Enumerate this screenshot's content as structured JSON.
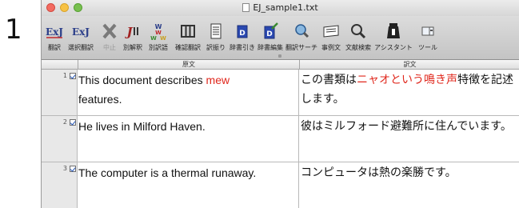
{
  "step_number": "1",
  "window": {
    "title": "EJ_sample1.txt"
  },
  "toolbar": {
    "items": [
      {
        "label": "翻訳",
        "icon": "ej-translate-icon",
        "glyph": "ExJ"
      },
      {
        "label": "選択翻訳",
        "icon": "ej-selection-translate-icon",
        "glyph": "ExJ"
      },
      {
        "label": "中止",
        "icon": "stop-x-icon",
        "disabled": true
      },
      {
        "label": "別解釈",
        "icon": "alt-interpretation-icon",
        "glyph": "J"
      },
      {
        "label": "別訳語",
        "icon": "alt-word-icon"
      },
      {
        "label": "確認翻訳",
        "icon": "column-view-icon"
      },
      {
        "label": "訳振り",
        "icon": "interlinear-icon"
      },
      {
        "label": "辞書引き",
        "icon": "dictionary-lookup-icon",
        "glyph": "D"
      },
      {
        "label": "辞書編集",
        "icon": "dictionary-edit-icon",
        "glyph": "D"
      },
      {
        "label": "翻訳サーチ",
        "icon": "translation-search-icon"
      },
      {
        "label": "事例文",
        "icon": "example-sentence-icon"
      },
      {
        "label": "文献検索",
        "icon": "literature-search-icon"
      },
      {
        "label": "アシスタント",
        "icon": "assistant-icon"
      },
      {
        "label": "ツール",
        "icon": "tools-icon"
      }
    ]
  },
  "columns": {
    "source": "原文",
    "target": "訳文"
  },
  "rows": [
    {
      "num": "1",
      "source_a": "This document describes ",
      "source_hl": "mew",
      "source_b": "features.",
      "target_a": "この書類は",
      "target_hl": "ニャオという鳴き声",
      "target_b": "特徴を記述します。"
    },
    {
      "num": "2",
      "source_a": "He lives in Milford Haven.",
      "target_a": "彼はミルフォード避難所に住んでいます。"
    },
    {
      "num": "3",
      "source_a": "The computer is a thermal runaway.",
      "target_a": "コンピュータは熱の楽勝です。"
    }
  ],
  "colors": {
    "highlight": "#e0281d",
    "check": "#2355b8"
  }
}
